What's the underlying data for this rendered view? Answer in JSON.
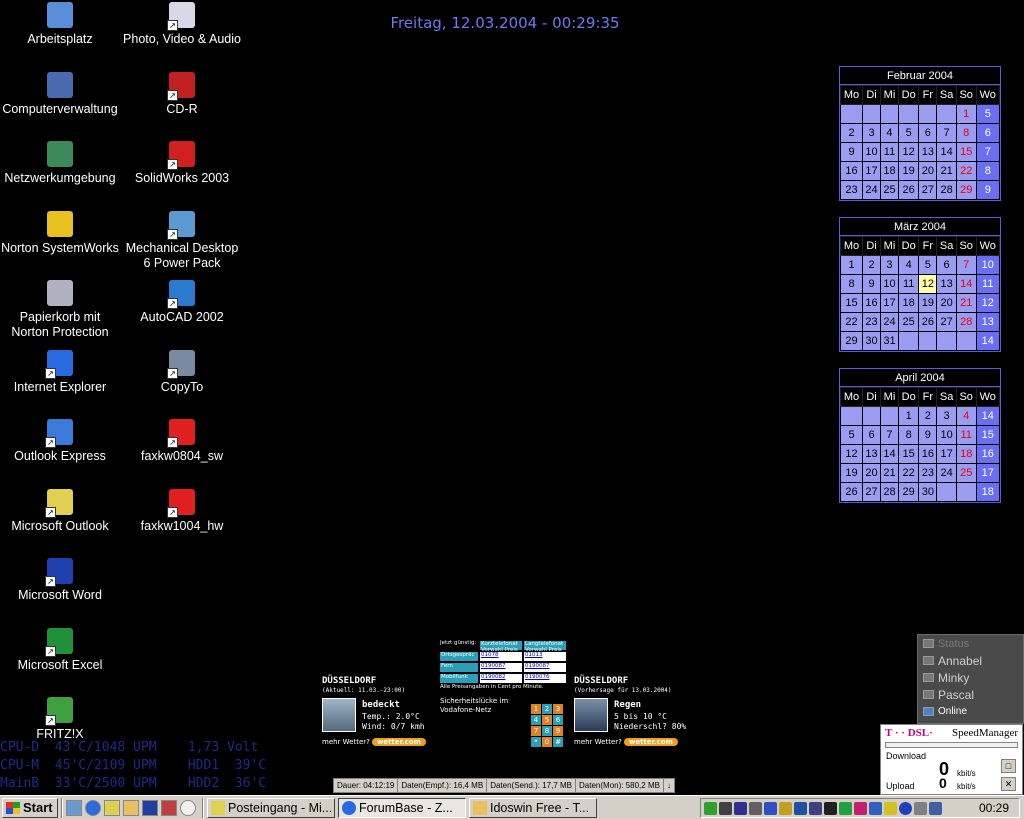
{
  "desktop": {
    "datetime": "Freitag, 12.03.2004 - 00:29:35",
    "icons_left": [
      {
        "label": "Arbeitsplatz",
        "icon": "computer-icon",
        "color": "#5a8fd8"
      },
      {
        "label": "Computerverwaltung",
        "icon": "computer-management-icon",
        "color": "#4a6ab0"
      },
      {
        "label": "Netzwerkumgebung",
        "icon": "network-icon",
        "color": "#3c8a5a"
      },
      {
        "label": "Norton SystemWorks",
        "icon": "norton-icon",
        "color": "#e8c020"
      },
      {
        "label": "Papierkorb mit Norton Protection",
        "icon": "recycle-bin-icon",
        "color": "#b0b0c0"
      },
      {
        "label": "Internet Explorer",
        "icon": "internet-explorer-icon",
        "color": "#2a6ae0"
      },
      {
        "label": "Outlook Express",
        "icon": "outlook-express-icon",
        "color": "#3a7ad8"
      },
      {
        "label": "Microsoft Outlook",
        "icon": "outlook-icon",
        "color": "#e0d050"
      },
      {
        "label": "Microsoft Word",
        "icon": "word-icon",
        "color": "#2040b0"
      },
      {
        "label": "Microsoft Excel",
        "icon": "excel-icon",
        "color": "#20903a"
      },
      {
        "label": "FRITZ!X",
        "icon": "fritzx-icon",
        "color": "#40a040"
      }
    ],
    "icons_right": [
      {
        "label": "Photo, Video & Audio",
        "icon": "media-folder-icon",
        "color": "#d8d8e8"
      },
      {
        "label": "CD-R",
        "icon": "cd-r-icon",
        "color": "#c02020"
      },
      {
        "label": "SolidWorks 2003",
        "icon": "solidworks-icon",
        "color": "#d02020"
      },
      {
        "label": "Mechanical Desktop 6 Power Pack",
        "icon": "mechanical-desktop-icon",
        "color": "#5a9ad0"
      },
      {
        "label": "AutoCAD 2002",
        "icon": "autocad-icon",
        "color": "#2a7ad0"
      },
      {
        "label": "CopyTo",
        "icon": "copyto-icon",
        "color": "#7a8aa0"
      },
      {
        "label": "faxkw0804_sw",
        "icon": "pdf-icon",
        "color": "#e02020"
      },
      {
        "label": "faxkw1004_hw",
        "icon": "pdf-icon",
        "color": "#e02020"
      }
    ]
  },
  "calendar": {
    "headers": [
      "Mo",
      "Di",
      "Mi",
      "Do",
      "Fr",
      "Sa",
      "So",
      "Wo"
    ],
    "months": [
      {
        "title": "Februar 2004",
        "weeks": [
          [
            "",
            "",
            "",
            "",
            "",
            "",
            "1",
            "5"
          ],
          [
            "2",
            "3",
            "4",
            "5",
            "6",
            "7",
            "8",
            "6"
          ],
          [
            "9",
            "10",
            "11",
            "12",
            "13",
            "14",
            "15",
            "7"
          ],
          [
            "16",
            "17",
            "18",
            "19",
            "20",
            "21",
            "22",
            "8"
          ],
          [
            "23",
            "24",
            "25",
            "26",
            "27",
            "28",
            "29",
            "9"
          ]
        ]
      },
      {
        "title": "März 2004",
        "today": "12",
        "weeks": [
          [
            "1",
            "2",
            "3",
            "4",
            "5",
            "6",
            "7",
            "10"
          ],
          [
            "8",
            "9",
            "10",
            "11",
            "12",
            "13",
            "14",
            "11"
          ],
          [
            "15",
            "16",
            "17",
            "18",
            "19",
            "20",
            "21",
            "12"
          ],
          [
            "22",
            "23",
            "24",
            "25",
            "26",
            "27",
            "28",
            "13"
          ],
          [
            "29",
            "30",
            "31",
            "",
            "",
            "",
            "",
            "14"
          ]
        ]
      },
      {
        "title": "April 2004",
        "weeks": [
          [
            "",
            "",
            "",
            "1",
            "2",
            "3",
            "4",
            "14"
          ],
          [
            "5",
            "6",
            "7",
            "8",
            "9",
            "10",
            "11",
            "15"
          ],
          [
            "12",
            "13",
            "14",
            "15",
            "16",
            "17",
            "18",
            "16"
          ],
          [
            "19",
            "20",
            "21",
            "22",
            "23",
            "24",
            "25",
            "17"
          ],
          [
            "26",
            "27",
            "28",
            "29",
            "30",
            "",
            "",
            "18"
          ]
        ]
      }
    ]
  },
  "weather": {
    "left": {
      "city": "DÜSSELDORF",
      "sub": "(Aktuell: 11.03.-23:00)",
      "cond": "bedeckt",
      "details": "Temp.: 2.0°C\nWind: 0/7 kmh",
      "more": "mehr Wetter?",
      "badge": "wetter.com"
    },
    "right": {
      "city": "DÜSSELDORF",
      "sub": "(Vorhersage für 13.03.2004)",
      "cond": "Regen",
      "details": "5 bis 10 °C\nNiederschl? 80%",
      "more": "mehr Wetter?",
      "badge": "wetter.com"
    },
    "tariff": {
      "jetzt": "Jetzt günstig:",
      "col1": "Kurztelefonat Vorwahl Preis",
      "col2": "Langtelefonat Vorwahl Preis",
      "rows": [
        {
          "label": "Ortsgespräc",
          "a": "01078",
          "b": "01013"
        },
        {
          "label": "Fern",
          "a": "0190087",
          "b": "0190087"
        },
        {
          "label": "Mobilfunk",
          "a": "0190082",
          "b": "0190076"
        }
      ],
      "note": "Alle Preisangaben in Cent pro Minute.",
      "ad": "Sicherheitslücke im Vodafone-Netz",
      "keys": [
        "1",
        "2",
        "3",
        "4",
        "5",
        "6",
        "7",
        "8",
        "9",
        "*",
        "0",
        "#"
      ]
    }
  },
  "sysmon": {
    "line1": "CPU-D  43'C/1048 UPM    1,73 Volt",
    "line2": "CPU-M  45'C/2109 UPM    HDD1  39'C",
    "line3": "MainB  33'C/2500 UPM    HDD2  36'C"
  },
  "traffic": {
    "dauer": "Dauer: 04:12:19",
    "empf": "Daten(Empf.): 16,4 MB",
    "send": "Daten(Send.): 17,7 MB",
    "mon": "Daten(Mon): 580,2 MB"
  },
  "buddies": {
    "status": "Status",
    "items": [
      "Annabel",
      "Minky",
      "Pascal"
    ],
    "online": "Online"
  },
  "speed": {
    "brand": "T · · DSL·",
    "title": "SpeedManager",
    "download_label": "Download",
    "download_value": "0",
    "upload_label": "Upload",
    "upload_value": "0",
    "unit": "kbit/s"
  },
  "taskbar": {
    "start": "Start",
    "tasks": [
      {
        "label": "Posteingang - Mi...",
        "active": false
      },
      {
        "label": "ForumBase - Z...",
        "active": true
      },
      {
        "label": "Idoswin Free - T...",
        "active": false
      }
    ],
    "clock": "00:29"
  }
}
